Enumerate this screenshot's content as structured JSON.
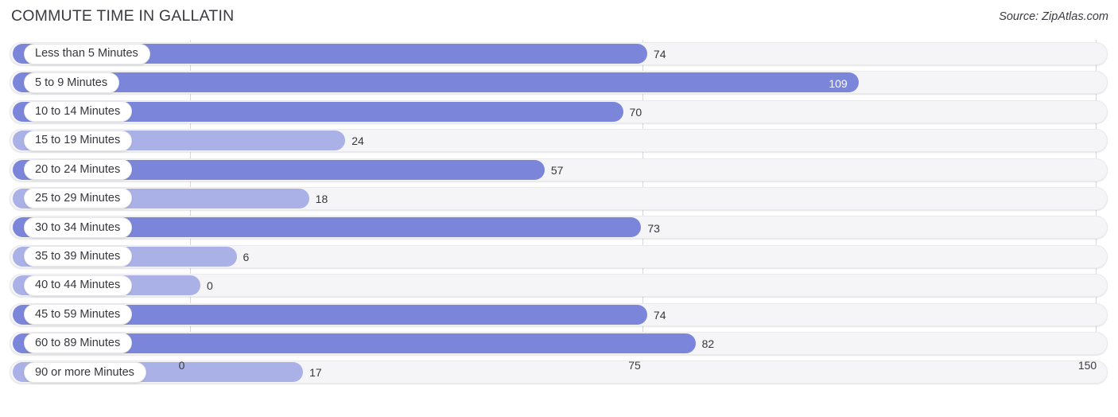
{
  "header": {
    "title": "COMMUTE TIME IN GALLATIN",
    "source": "Source: ZipAtlas.com"
  },
  "colors": {
    "bar_strong": "#7b86da",
    "bar_light": "#a9b1e6",
    "track": "#f5f5f7",
    "gridline": "#d8d8dc",
    "text": "#36363c"
  },
  "chart_data": {
    "type": "bar",
    "orientation": "horizontal",
    "title": "COMMUTE TIME IN GALLATIN",
    "xlabel": "",
    "ylabel": "",
    "xlim": [
      0,
      150
    ],
    "grid": true,
    "legend": false,
    "ticks": [
      "0",
      "75",
      "150"
    ],
    "tick_values": [
      0,
      75,
      150
    ],
    "categories": [
      "Less than 5 Minutes",
      "5 to 9 Minutes",
      "10 to 14 Minutes",
      "15 to 19 Minutes",
      "20 to 24 Minutes",
      "25 to 29 Minutes",
      "30 to 34 Minutes",
      "35 to 39 Minutes",
      "40 to 44 Minutes",
      "45 to 59 Minutes",
      "60 to 89 Minutes",
      "90 or more Minutes"
    ],
    "values": [
      74,
      109,
      70,
      24,
      57,
      18,
      73,
      6,
      0,
      74,
      82,
      17
    ],
    "labels": [
      "74",
      "109",
      "70",
      "24",
      "57",
      "18",
      "73",
      "6",
      "0",
      "74",
      "82",
      "17"
    ]
  }
}
